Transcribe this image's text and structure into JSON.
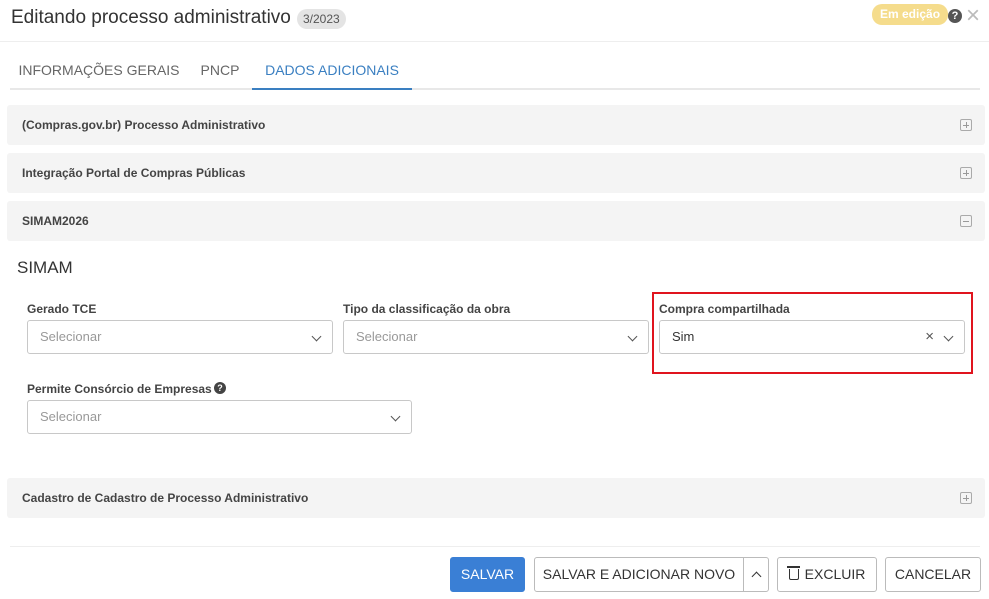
{
  "header": {
    "title": "Editando processo administrativo",
    "process_number": "3/2023",
    "status": "Em edição",
    "help": "?",
    "close": "×"
  },
  "tabs": [
    {
      "label": "INFORMAÇÕES GERAIS",
      "active": false
    },
    {
      "label": "PNCP",
      "active": false
    },
    {
      "label": "DADOS ADICIONAIS",
      "active": true
    }
  ],
  "panels": {
    "compras": {
      "title": "(Compras.gov.br) Processo Administrativo",
      "expanded": false
    },
    "portal": {
      "title": "Integração Portal de Compras Públicas",
      "expanded": false
    },
    "simam": {
      "title": "SIMAM2026",
      "expanded": true
    },
    "cadastro": {
      "title": "Cadastro de Cadastro de Processo Administrativo",
      "expanded": false
    }
  },
  "simam": {
    "section_title": "SIMAM",
    "fields": {
      "gerado_tce": {
        "label": "Gerado TCE",
        "value": "",
        "placeholder": "Selecionar"
      },
      "tipo_obra": {
        "label": "Tipo da classificação da obra",
        "value": "",
        "placeholder": "Selecionar"
      },
      "compra_compartilhada": {
        "label": "Compra compartilhada",
        "value": "Sim",
        "clear": "×"
      },
      "consorcio": {
        "label": "Permite Consórcio de Empresas",
        "value": "",
        "placeholder": "Selecionar",
        "help": "?"
      }
    }
  },
  "footer": {
    "save": "SALVAR",
    "save_add_new": "SALVAR E ADICIONAR NOVO",
    "delete": "EXCLUIR",
    "cancel": "CANCELAR"
  },
  "colors": {
    "primary": "#3a7fd5",
    "active_tab": "#3a7fc1",
    "status_badge": "#f5dc8c",
    "highlight_border": "#e0141e"
  }
}
